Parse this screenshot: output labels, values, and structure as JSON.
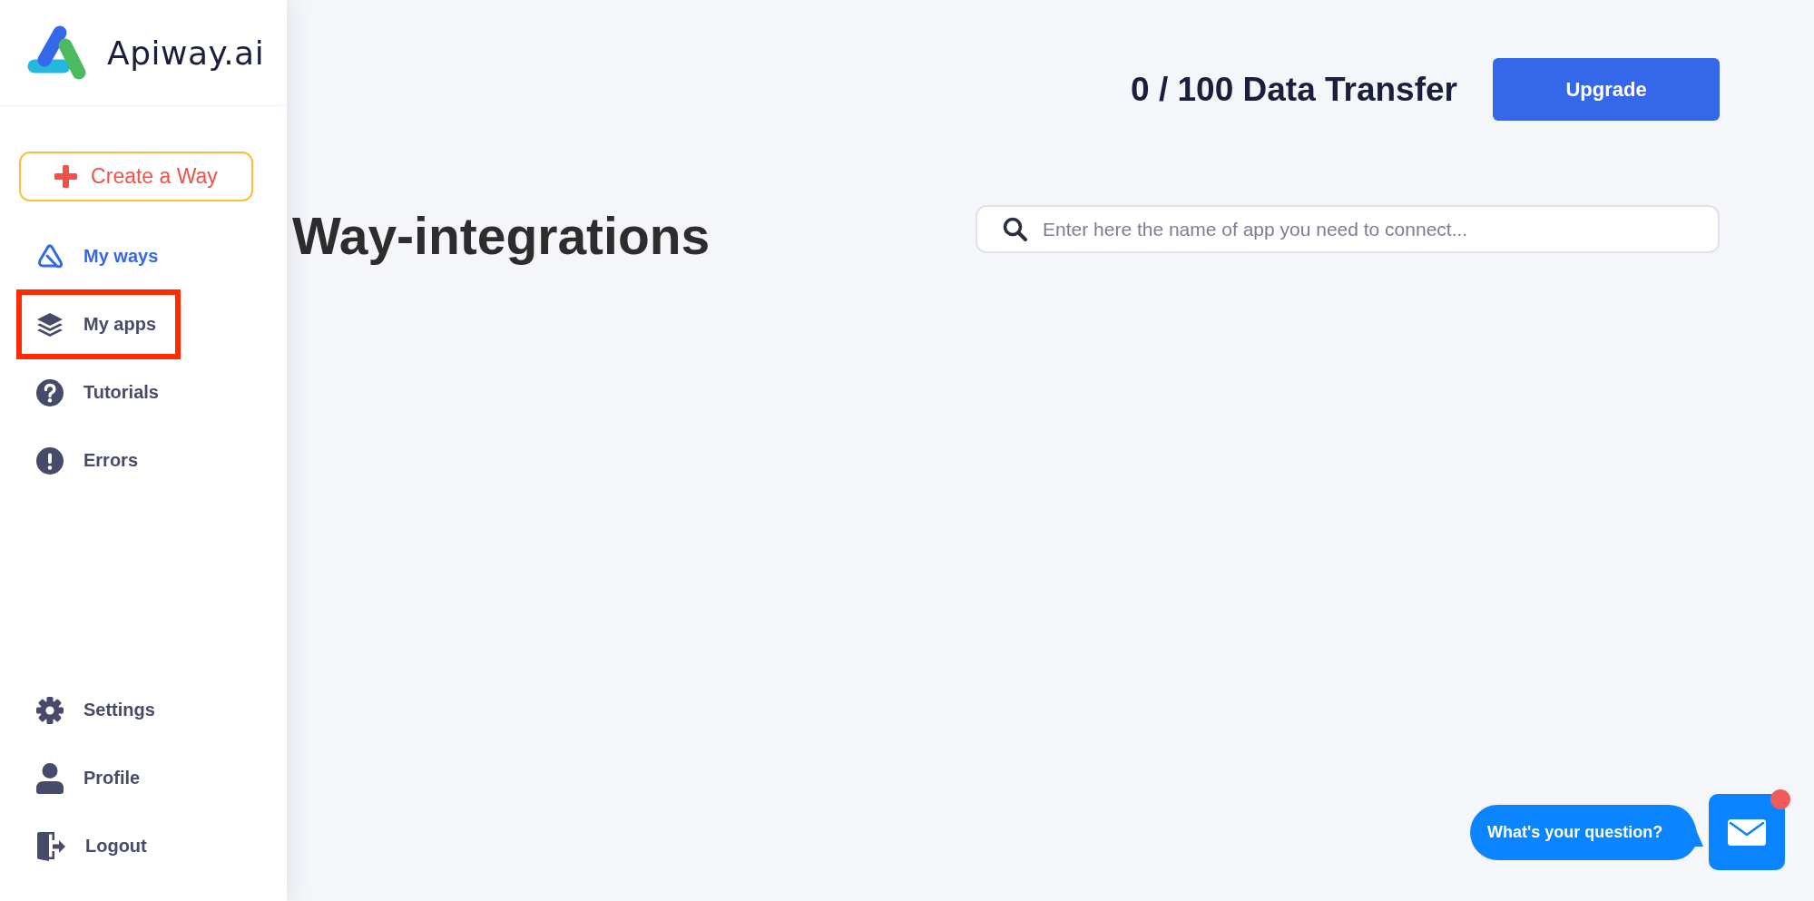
{
  "sidebar": {
    "logo": {
      "text": "Apiway.ai"
    },
    "create_button": {
      "label": "Create a Way"
    },
    "nav": [
      {
        "label": "My ways",
        "selected": true,
        "highlighted": false
      },
      {
        "label": "My apps",
        "selected": false,
        "highlighted": true
      },
      {
        "label": "Tutorials",
        "selected": false,
        "highlighted": false
      },
      {
        "label": "Errors",
        "selected": false,
        "highlighted": false
      }
    ],
    "bottom_nav": [
      {
        "label": "Settings",
        "selected": false,
        "highlighted": false
      },
      {
        "label": "Profile",
        "selected": false,
        "highlighted": false
      },
      {
        "label": "Logout",
        "selected": false,
        "highlighted": false
      }
    ]
  },
  "header": {
    "usage": "0 / 100 Data Transfer",
    "upgrade_button": "Upgrade"
  },
  "page_title": "Way-integrations",
  "search": {
    "placeholder": "Enter here the name of app you need to connect..."
  },
  "chat": {
    "prompt": "What's your question?",
    "unread": true
  }
}
